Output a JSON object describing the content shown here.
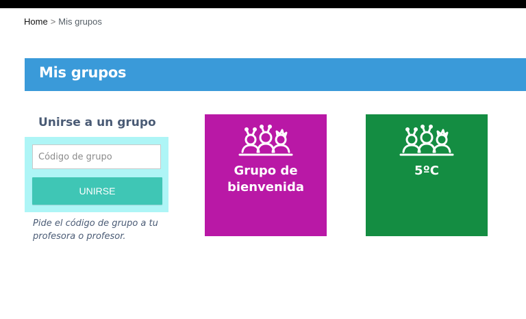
{
  "colors": {
    "banner": "#3a9ad9",
    "join_box": "#aef5f6",
    "join_button": "#3fc6b5",
    "join_button_text": "#ffffff",
    "card_magenta": "#b918a6",
    "card_green": "#148d42"
  },
  "breadcrumb": {
    "home": "Home",
    "separator": ">",
    "current": "Mis grupos"
  },
  "banner": {
    "title": "Mis grupos"
  },
  "join": {
    "title": "Unirse a un grupo",
    "input_placeholder": "Código de grupo",
    "input_value": "",
    "button_label": "UNIRSE",
    "hint": "Pide el código de grupo a tu profesora o profesor."
  },
  "groups": [
    {
      "name_line1": "Grupo de",
      "name_line2": "bienvenida",
      "icon": "people-group-icon",
      "color": "magenta"
    },
    {
      "name_line1": "5ºC",
      "name_line2": "",
      "icon": "people-group-icon",
      "color": "green"
    }
  ]
}
